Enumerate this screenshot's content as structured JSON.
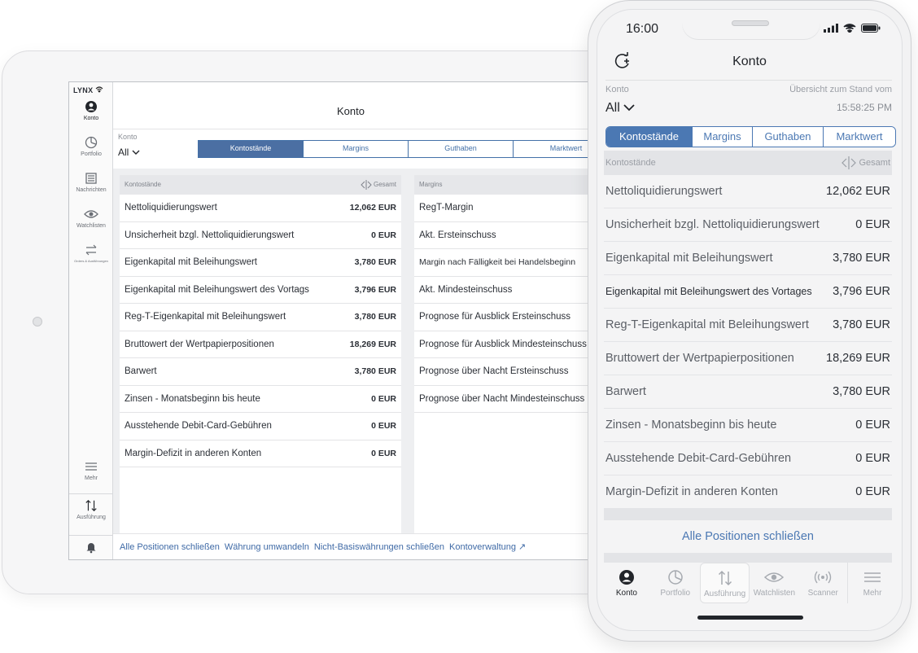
{
  "tablet": {
    "brand": "LYNX",
    "rail": [
      {
        "label": "Konto"
      },
      {
        "label": "Portfolio"
      },
      {
        "label": "Nachrichten"
      },
      {
        "label": "Watchlisten"
      },
      {
        "label": "Orders & Ausführungen"
      }
    ],
    "rail_bottom": [
      {
        "label": "Mehr"
      },
      {
        "label": "Ausführung"
      }
    ],
    "title": "Konto",
    "konto_label": "Konto",
    "konto_value": "All",
    "tabs": [
      "Kontostände",
      "Margins",
      "Guthaben",
      "Marktwert"
    ],
    "left_card": {
      "header": "Kontostände",
      "gesamt": "Gesamt",
      "rows": [
        {
          "label": "Nettoliquidierungswert",
          "value": "12,062 EUR"
        },
        {
          "label": "Unsicherheit bzgl. Nettoliquidierungswert",
          "value": "0 EUR"
        },
        {
          "label": "Eigenkapital mit Beleihungswert",
          "value": "3,780 EUR"
        },
        {
          "label": "Eigenkapital mit Beleihungswert des Vortags",
          "value": "3,796 EUR"
        },
        {
          "label": "Reg-T-Eigenkapital mit Beleihungswert",
          "value": "3,780 EUR"
        },
        {
          "label": "Bruttowert der Wertpapierpositionen",
          "value": "18,269 EUR"
        },
        {
          "label": "Barwert",
          "value": "3,780 EUR"
        },
        {
          "label": "Zinsen - Monatsbeginn bis heute",
          "value": "0 EUR"
        },
        {
          "label": "Ausstehende Debit-Card-Gebühren",
          "value": "0 EUR"
        },
        {
          "label": "Margin-Defizit in anderen Konten",
          "value": "0 EUR"
        }
      ]
    },
    "right_card": {
      "header": "Margins",
      "rows": [
        {
          "label": "RegT-Margin"
        },
        {
          "label": "Akt. Ersteinschuss"
        },
        {
          "label": "Margin nach Fälligkeit bei Handelsbeginn"
        },
        {
          "label": "Akt. Mindesteinschuss"
        },
        {
          "label": "Prognose für Ausblick Ersteinschuss"
        },
        {
          "label": "Prognose für Ausblick Mindesteinschuss"
        },
        {
          "label": "Prognose über Nacht Ersteinschuss"
        },
        {
          "label": "Prognose über Nacht Mindesteinschuss"
        }
      ]
    },
    "footer_links": [
      "Alle Positionen schließen",
      "Währung umwandeln",
      "Nicht-Basiswährungen schließen",
      "Kontoverwaltung ↗"
    ]
  },
  "phone": {
    "time": "16:00",
    "title": "Konto",
    "konto_label": "Konto",
    "uebersicht": "Übersicht zum Stand vom",
    "konto_value": "All",
    "stand_time": "15:58:25 PM",
    "tabs": [
      "Kontostände",
      "Margins",
      "Guthaben",
      "Marktwert"
    ],
    "header": "Kontostände",
    "gesamt": "Gesamt",
    "rows": [
      {
        "label": "Nettoliquidierungswert",
        "value": "12,062 EUR"
      },
      {
        "label": "Unsicherheit bzgl. Nettoliquidierungswert",
        "value": "0 EUR"
      },
      {
        "label": "Eigenkapital mit Beleihungswert",
        "value": "3,780 EUR"
      },
      {
        "label": "Eigenkapital mit Beleihungswert des Vortages",
        "value": "3,796 EUR"
      },
      {
        "label": "Reg-T-Eigenkapital mit Beleihungswert",
        "value": "3,780 EUR"
      },
      {
        "label": "Bruttowert der Wertpapierpositionen",
        "value": "18,269 EUR"
      },
      {
        "label": "Barwert",
        "value": "3,780 EUR"
      },
      {
        "label": "Zinsen - Monatsbeginn bis heute",
        "value": "0 EUR"
      },
      {
        "label": "Ausstehende Debit-Card-Gebühren",
        "value": "0 EUR"
      },
      {
        "label": "Margin-Defizit in anderen Konten",
        "value": "0 EUR"
      }
    ],
    "action": "Alle Positionen schließen",
    "nav": [
      "Konto",
      "Portfolio",
      "Ausführung",
      "Watchlisten",
      "Scanner",
      "Mehr"
    ]
  },
  "colors": {
    "accent": "#4b78b3",
    "active_tab": "#4b6fa3",
    "link": "#3f6aa6"
  }
}
